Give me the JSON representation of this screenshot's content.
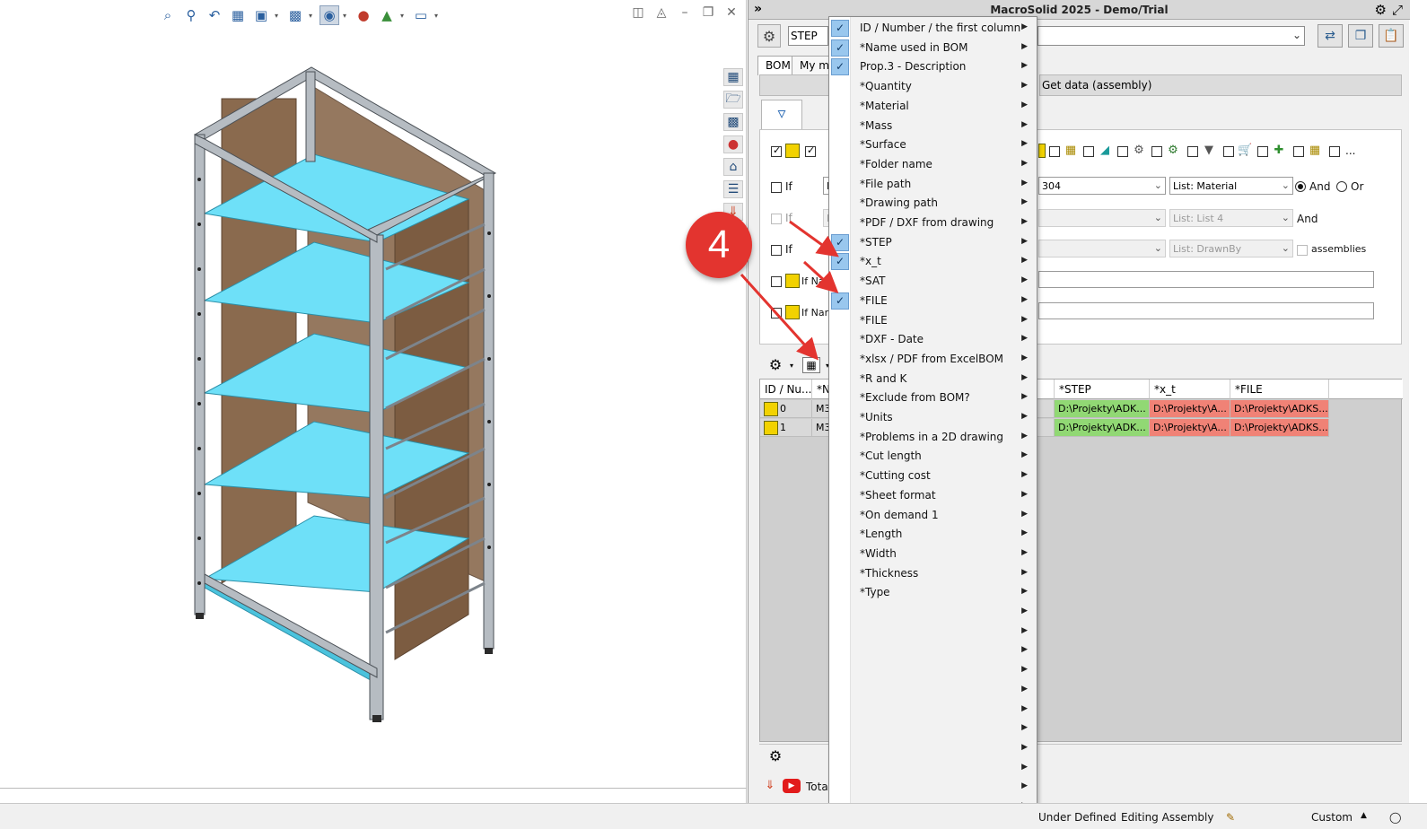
{
  "app": {
    "title": "MacroSolid 2025 - Demo/Trial"
  },
  "header": {
    "combo_value": "STEP"
  },
  "tabs": [
    {
      "label": "BOM"
    },
    {
      "label": "My mac"
    }
  ],
  "get_data_label": "Get data (assembly)",
  "filters": {
    "if_label": "If",
    "row1": {
      "value_combo": "304",
      "list_combo": "List: Material",
      "and_label": "And",
      "or_label": "Or"
    },
    "row2": {
      "list_combo": "List: List 4",
      "and_label": "And"
    },
    "row3": {
      "list_combo": "List: DrawnBy",
      "assemblies_label": "assemblies"
    },
    "row4_label": "If Nam",
    "row5_label": "If Nam",
    "partial_f1": "F",
    "partial_f2": "F",
    "ellipsis": "..."
  },
  "grid": {
    "columns": [
      {
        "label": "ID / Nu..."
      },
      {
        "label": "*Na"
      },
      {
        "label": "*STEP"
      },
      {
        "label": "*x_t"
      },
      {
        "label": "*FILE"
      }
    ],
    "rows": [
      {
        "id": "0",
        "name": "M3",
        "step": "D:\\Projekty\\ADK...",
        "xt": "D:\\Projekty\\A...",
        "file": "D:\\Projekty\\ADKS..."
      },
      {
        "id": "1",
        "name": "M3",
        "step": "D:\\Projekty\\ADK...",
        "xt": "D:\\Projekty\\A...",
        "file": "D:\\Projekty\\ADKS..."
      }
    ]
  },
  "total_label": "Total:",
  "context_menu": {
    "items": [
      {
        "label": "ID / Number / the first column",
        "checked": true
      },
      {
        "label": "*Name used in BOM",
        "checked": true
      },
      {
        "label": "Prop.3 - Description",
        "checked": true
      },
      {
        "label": "*Quantity",
        "checked": false
      },
      {
        "label": "*Material",
        "checked": false
      },
      {
        "label": "*Mass",
        "checked": false
      },
      {
        "label": "*Surface",
        "checked": false
      },
      {
        "label": "*Folder name",
        "checked": false
      },
      {
        "label": "*File path",
        "checked": false
      },
      {
        "label": "*Drawing path",
        "checked": false
      },
      {
        "label": "*PDF / DXF from drawing",
        "checked": false
      },
      {
        "label": "*STEP",
        "checked": true
      },
      {
        "label": "*x_t",
        "checked": true
      },
      {
        "label": "*SAT",
        "checked": false
      },
      {
        "label": "*FILE",
        "checked": true
      },
      {
        "label": "*FILE",
        "checked": false
      },
      {
        "label": "*DXF - Date",
        "checked": false
      },
      {
        "label": "*xlsx / PDF from ExcelBOM",
        "checked": false
      },
      {
        "label": "*R and K",
        "checked": false
      },
      {
        "label": "*Exclude from BOM?",
        "checked": false
      },
      {
        "label": "*Units",
        "checked": false
      },
      {
        "label": "*Problems in a 2D drawing",
        "checked": false
      },
      {
        "label": "*Cut length",
        "checked": false
      },
      {
        "label": "*Cutting cost",
        "checked": false
      },
      {
        "label": "*Sheet format",
        "checked": false
      },
      {
        "label": "*On demand 1",
        "checked": false
      },
      {
        "label": "*Length",
        "checked": false
      },
      {
        "label": "*Width",
        "checked": false
      },
      {
        "label": "*Thickness",
        "checked": false
      },
      {
        "label": "*Type",
        "checked": false
      },
      {
        "label": "",
        "checked": false
      },
      {
        "label": "",
        "checked": false
      },
      {
        "label": "",
        "checked": false
      },
      {
        "label": "",
        "checked": false
      },
      {
        "label": "",
        "checked": false
      },
      {
        "label": "",
        "checked": false
      },
      {
        "label": "",
        "checked": false
      },
      {
        "label": "",
        "checked": false
      },
      {
        "label": "",
        "checked": false
      },
      {
        "label": "",
        "checked": false
      },
      {
        "label": "",
        "checked": false
      }
    ]
  },
  "callout_number": "4",
  "statusbar": {
    "state": "Under Defined",
    "mode": "Editing Assembly",
    "units": "Custom"
  },
  "colors": {
    "shelf": "#6ee0f8",
    "panel_wood": "#8a6a4e",
    "frame": "#9aa3ab",
    "cell_green": "#91d874",
    "cell_red": "#f08276",
    "callout": "#e3342f"
  }
}
